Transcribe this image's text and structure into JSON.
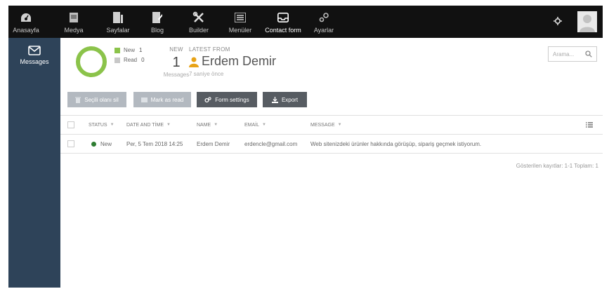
{
  "topbar": {
    "items": [
      {
        "label": "Anasayfa",
        "icon": "dashboard-icon"
      },
      {
        "label": "Medya",
        "icon": "media-icon"
      },
      {
        "label": "Sayfalar",
        "icon": "pages-icon"
      },
      {
        "label": "Blog",
        "icon": "blog-icon"
      },
      {
        "label": "Builder",
        "icon": "builder-icon"
      },
      {
        "label": "Menüler",
        "icon": "menu-icon"
      },
      {
        "label": "Contact form",
        "icon": "inbox-icon"
      },
      {
        "label": "Ayarlar",
        "icon": "gears-icon"
      }
    ],
    "active_index": 6
  },
  "sidebar": {
    "items": [
      {
        "label": "Messages",
        "icon": "envelope-icon"
      }
    ]
  },
  "stats": {
    "legend": [
      {
        "label": "New",
        "value": "1",
        "color": "#8bc34a"
      },
      {
        "label": "Read",
        "value": "0",
        "color": "#c8c8c8"
      }
    ],
    "new_label": "NEW",
    "new_count": "1",
    "new_sub": "Messages",
    "latest_label": "LATEST FROM",
    "latest_name": "Erdem Demir",
    "latest_time": "7 saniye önce"
  },
  "search": {
    "placeholder": "Arama..."
  },
  "toolbar": {
    "delete_label": "Seçili olanı sil",
    "mark_read_label": "Mark as read",
    "form_settings_label": "Form settings",
    "export_label": "Export"
  },
  "table": {
    "columns": [
      "STATUS",
      "DATE AND TİME",
      "NAME",
      "EMAİL",
      "MESSAGE"
    ],
    "rows": [
      {
        "status": "New",
        "date": "Per, 5 Tem 2018 14:25",
        "name": "Erdem Demir",
        "email": "erdencle@gmail.com",
        "message": "Web sitenizdeki ürünler hakkında görüşüp, sipariş geçmek istiyorum."
      }
    ],
    "footer": "Gösterilen kayıtlar: 1-1 Toplam: 1"
  },
  "colors": {
    "topbar_bg": "#111111",
    "sidebar_bg": "#2e4359",
    "accent_green": "#8bc34a",
    "status_new": "#2e7d32",
    "user_icon": "#e8a317"
  }
}
